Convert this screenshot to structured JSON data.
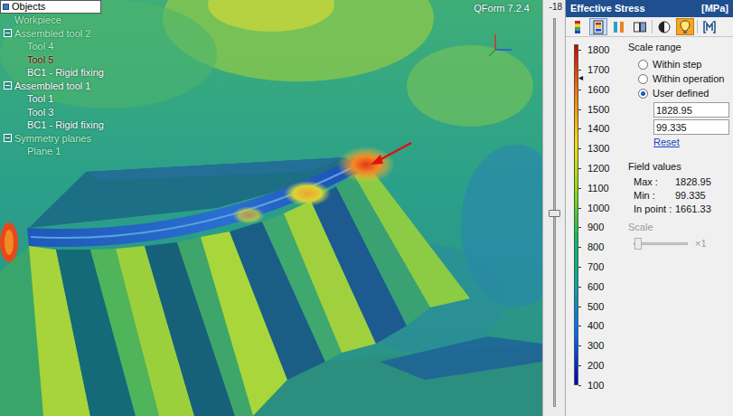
{
  "window": {
    "title": "QForm 7.2.4"
  },
  "tree": {
    "header": "Objects",
    "items": [
      {
        "label": "Workpiece",
        "kind": "leaf",
        "expanded": false,
        "dimmed": true,
        "selected": false,
        "children": []
      },
      {
        "label": "Assembled tool 2",
        "kind": "group",
        "expanded": true,
        "dimmed": true,
        "selected": false,
        "children": [
          {
            "label": "Tool 4",
            "kind": "leaf",
            "expanded": false,
            "dimmed": true,
            "selected": false,
            "children": []
          },
          {
            "label": "Tool 5",
            "kind": "leaf",
            "expanded": false,
            "dimmed": false,
            "selected": true,
            "children": []
          },
          {
            "label": "BC1 - Rigid fixing",
            "kind": "leaf",
            "expanded": false,
            "dimmed": false,
            "selected": false,
            "children": []
          }
        ]
      },
      {
        "label": "Assembled tool 1",
        "kind": "group",
        "expanded": true,
        "dimmed": false,
        "selected": false,
        "children": [
          {
            "label": "Tool 1",
            "kind": "leaf",
            "expanded": false,
            "dimmed": false,
            "selected": false,
            "children": []
          },
          {
            "label": "Tool 3",
            "kind": "leaf",
            "expanded": false,
            "dimmed": false,
            "selected": false,
            "children": []
          },
          {
            "label": "BC1 - Rigid fixing",
            "kind": "leaf",
            "expanded": false,
            "dimmed": false,
            "selected": false,
            "children": []
          }
        ]
      },
      {
        "label": "Symmetry planes",
        "kind": "group",
        "expanded": true,
        "dimmed": true,
        "selected": false,
        "children": [
          {
            "label": "Plane 1",
            "kind": "leaf",
            "expanded": false,
            "dimmed": true,
            "selected": false,
            "children": []
          }
        ]
      }
    ]
  },
  "view_slider": {
    "reading": "-18",
    "level": 0.5
  },
  "panel": {
    "title": "Effective Stress",
    "unit": "[MPa]",
    "toolbar": [
      {
        "kind": "palette",
        "selected": false
      },
      {
        "kind": "bands",
        "selected": true
      },
      {
        "kind": "legend",
        "selected": false
      },
      {
        "kind": "split",
        "selected": false
      },
      {
        "kind": "contrast",
        "selected": false
      },
      {
        "kind": "marker",
        "selected": true
      },
      {
        "kind": "settings",
        "selected": false
      }
    ],
    "scale": {
      "ticks": [
        "1800",
        "1700",
        "1600",
        "1500",
        "1400",
        "1300",
        "1200",
        "1100",
        "1000",
        "900",
        "800",
        "700",
        "600",
        "500",
        "400",
        "300",
        "200",
        "100"
      ],
      "marker": "◂",
      "marker_level": 0.903
    },
    "scale_range": {
      "title": "Scale range",
      "options": [
        {
          "label": "Within step",
          "selected": false
        },
        {
          "label": "Within operation",
          "selected": false
        },
        {
          "label": "User defined",
          "selected": true
        }
      ],
      "max": "1828.95",
      "min": "99.335",
      "reset": "Reset"
    },
    "field_values": {
      "title": "Field values",
      "rows": [
        {
          "label": "Max :",
          "value": "1828.95"
        },
        {
          "label": "Min :",
          "value": "99.335"
        },
        {
          "label": "In point :",
          "value": "1661.33"
        }
      ]
    },
    "scale_factor": {
      "label": "Scale",
      "level": 0,
      "reading": "×1",
      "disabled": true
    }
  }
}
